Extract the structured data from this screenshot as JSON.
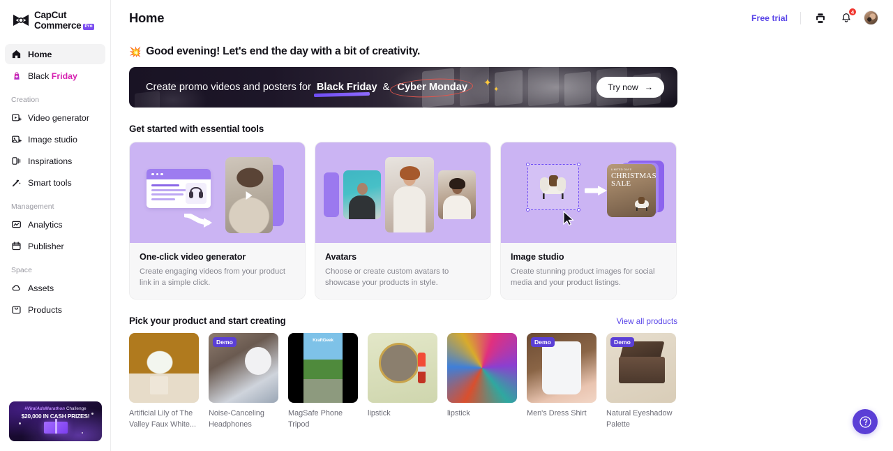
{
  "brand": {
    "name_line1": "CapCut",
    "name_line2": "Commerce",
    "pro_badge": "Pro"
  },
  "sidebar": {
    "primary": [
      {
        "label": "Home",
        "icon": "home-icon",
        "active": true
      },
      {
        "label_prefix": "Black ",
        "label_suffix": "Friday",
        "icon": "bag-icon",
        "active": false
      }
    ],
    "sections": [
      {
        "title": "Creation",
        "items": [
          {
            "label": "Video generator",
            "icon": "video-icon"
          },
          {
            "label": "Image studio",
            "icon": "image-icon"
          },
          {
            "label": "Inspirations",
            "icon": "inspirations-icon"
          },
          {
            "label": "Smart tools",
            "icon": "wand-icon"
          }
        ]
      },
      {
        "title": "Management",
        "items": [
          {
            "label": "Analytics",
            "icon": "analytics-icon"
          },
          {
            "label": "Publisher",
            "icon": "calendar-icon"
          }
        ]
      },
      {
        "title": "Space",
        "items": [
          {
            "label": "Assets",
            "icon": "cloud-icon"
          },
          {
            "label": "Products",
            "icon": "box-icon"
          }
        ]
      }
    ],
    "promo": {
      "line1_tag": "#ViralAdsMarathon",
      "line1_rest": " Challenge",
      "line2": "$20,000 IN CASH PRIZES!"
    }
  },
  "header": {
    "title": "Home",
    "free_trial": "Free trial",
    "print_icon": "printer-icon",
    "bell_icon": "bell-icon",
    "notification_count": "4",
    "avatar": "user-avatar"
  },
  "greeting": {
    "emoji": "💥",
    "text": "Good evening! Let's end the day with a bit of creativity."
  },
  "hero": {
    "text_before": "Create promo videos and posters for",
    "highlight_1": "Black Friday",
    "conjunction": "&",
    "highlight_2": "Cyber Monday",
    "cta": "Try now",
    "cta_arrow": "→"
  },
  "tools_section": {
    "heading": "Get started with essential tools",
    "cards": [
      {
        "title": "One-click video generator",
        "desc": "Create engaging videos from your product link in a simple click."
      },
      {
        "title": "Avatars",
        "desc": "Choose or create custom avatars to showcase your products in style."
      },
      {
        "title": "Image studio",
        "desc": "Create stunning product images for social media and your product listings."
      }
    ],
    "card3_poster_small": "LIMITED DAYS",
    "card3_poster_line1": "CHRISTMAS",
    "card3_poster_line2": "SALE"
  },
  "products_section": {
    "heading": "Pick your product and start creating",
    "view_all": "View all products",
    "demo_label": "Demo",
    "items": [
      {
        "name": "Artificial Lily of The Valley Faux White...",
        "demo": false
      },
      {
        "name": "Noise-Canceling Headphones",
        "demo": true
      },
      {
        "name": "MagSafe Phone Tripod",
        "demo": false,
        "overlay_logo": "KraftGeek"
      },
      {
        "name": "lipstick",
        "demo": false
      },
      {
        "name": "lipstick",
        "demo": false
      },
      {
        "name": "Men's Dress Shirt",
        "demo": true
      },
      {
        "name": "Natural Eyeshadow Palette",
        "demo": true
      }
    ]
  },
  "help": {
    "icon": "question-mark-icon",
    "label": "?"
  },
  "colors": {
    "accent_purple": "#5b3fd6",
    "link_purple": "#5a46e8",
    "card_lavender": "#cbb4f3",
    "friday_pink": "#d61fb0",
    "badge_red": "#f0352e",
    "hero_dark": "#191324"
  }
}
